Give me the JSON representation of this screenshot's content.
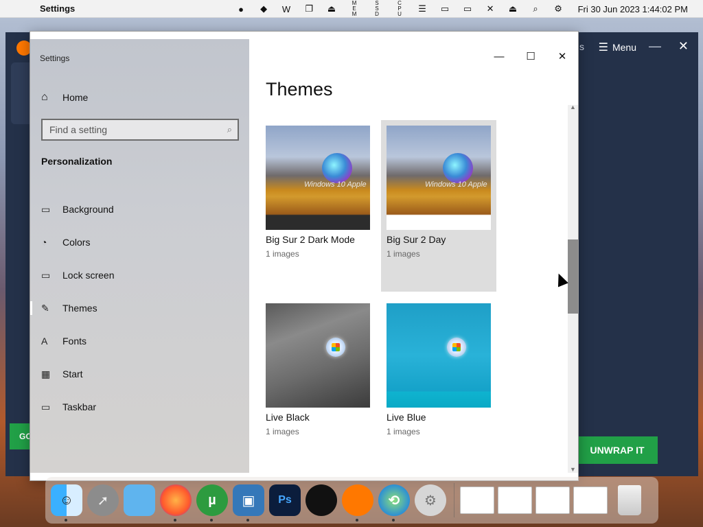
{
  "menubar": {
    "app_name": "Settings",
    "clock": "Fri 30 Jun 2023 1:44:02 PM",
    "status_icons": [
      {
        "name": "disk-icon",
        "glyph": "●"
      },
      {
        "name": "cube-icon",
        "glyph": "◆"
      },
      {
        "name": "w-icon",
        "glyph": "W"
      },
      {
        "name": "copy-icon",
        "glyph": "❐"
      },
      {
        "name": "eject-circle-icon",
        "glyph": "⏏"
      },
      {
        "name": "mem-icon",
        "glyph": "▯",
        "text": "MEM"
      },
      {
        "name": "ssd-icon",
        "glyph": "▯",
        "text": "SSD"
      },
      {
        "name": "cpu-icon",
        "glyph": "▯",
        "text": "CPU"
      },
      {
        "name": "list-icon",
        "glyph": "☰"
      },
      {
        "name": "gpu-icon",
        "glyph": "▭"
      },
      {
        "name": "display-icon",
        "glyph": "▭"
      },
      {
        "name": "mute-icon",
        "glyph": "🔇"
      },
      {
        "name": "eject-icon",
        "glyph": "⏏"
      },
      {
        "name": "search-icon",
        "glyph": "⌕"
      },
      {
        "name": "control-center-icon",
        "glyph": "⚙"
      }
    ]
  },
  "bg_app": {
    "tab_partial": "s",
    "menu_label": "Menu",
    "cta_label": "UNWRAP IT",
    "go_label": "GO",
    "accent": "#21a047"
  },
  "settings": {
    "window_title": "Settings",
    "home_label": "Home",
    "search_placeholder": "Find a setting",
    "section_title": "Personalization",
    "nav_items": [
      {
        "label": "Background",
        "icon": "picture-icon",
        "glyph": "▭"
      },
      {
        "label": "Colors",
        "icon": "palette-icon",
        "glyph": "◔"
      },
      {
        "label": "Lock screen",
        "icon": "lock-screen-icon",
        "glyph": "▭"
      },
      {
        "label": "Themes",
        "icon": "brush-icon",
        "glyph": "✎"
      },
      {
        "label": "Fonts",
        "icon": "fonts-icon",
        "glyph": "A"
      },
      {
        "label": "Start",
        "icon": "start-icon",
        "glyph": "▦"
      },
      {
        "label": "Taskbar",
        "icon": "taskbar-icon",
        "glyph": "▭"
      }
    ],
    "active_item": "Themes",
    "page_title": "Themes",
    "themes": [
      {
        "name": "Big Sur 2 Dark Mode",
        "count": "1 images",
        "watermark": "Windows 10 Apple"
      },
      {
        "name": "Big Sur 2 Day",
        "count": "1 images",
        "watermark": "Windows 10 Apple"
      },
      {
        "name": "Live Black",
        "count": "1 images"
      },
      {
        "name": "Live Blue",
        "count": "1 images"
      }
    ]
  },
  "dock": {
    "items": [
      "finder",
      "launchpad",
      "folder",
      "firefox",
      "utorrent",
      "virtualbox",
      "photoshop",
      "apple",
      "avast",
      "globe",
      "settings"
    ]
  }
}
